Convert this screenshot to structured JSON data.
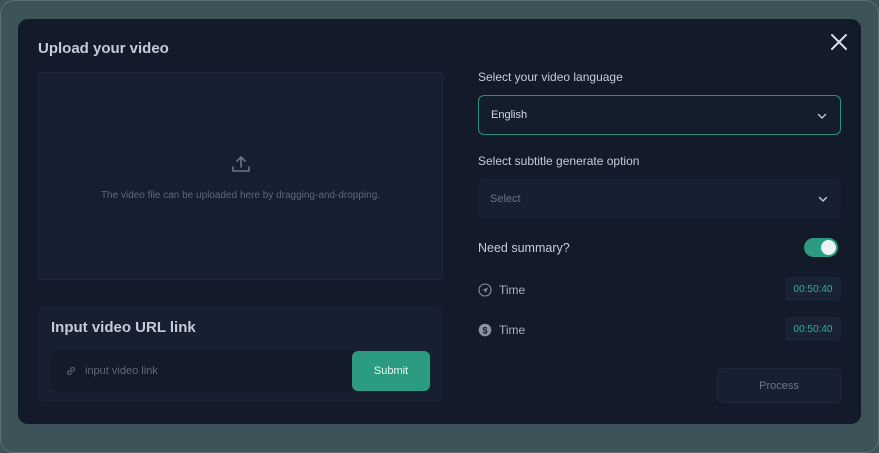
{
  "upload": {
    "title": "Upload your video",
    "dropzone_text": "The video file can be uploaded here by dragging-and-dropping."
  },
  "url_link": {
    "title": "Input video URL link",
    "placeholder": "input video link",
    "submit_label": "Submit"
  },
  "language": {
    "label": "Select your video language",
    "selected": "English"
  },
  "subtitle": {
    "label": "Select subtitle generate option",
    "placeholder": "Select"
  },
  "summary": {
    "label": "Need summary?",
    "enabled": true
  },
  "times": [
    {
      "icon": "navigation-arrow-icon",
      "label": "Time",
      "value": "00:50:40"
    },
    {
      "icon": "dollar-coin-icon",
      "label": "Time",
      "value": "00:50:40"
    }
  ],
  "process_label": "Process",
  "colors": {
    "accent": "#2b9c82",
    "accent_text": "#2fb08f",
    "modal_bg": "#131b2a",
    "backdrop": "#3e5358"
  }
}
